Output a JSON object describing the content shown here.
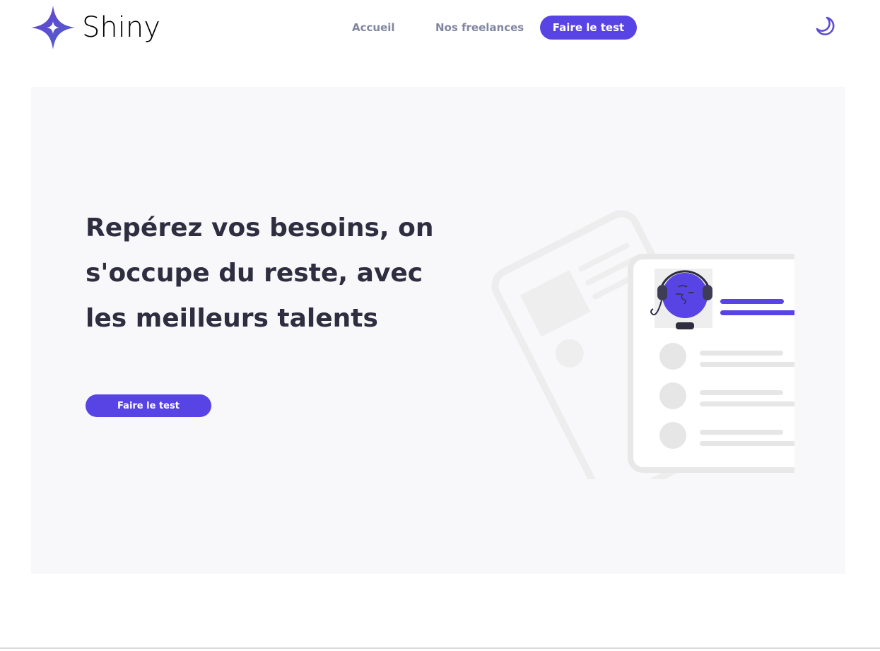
{
  "header": {
    "brand": "Shiny",
    "nav": {
      "home": "Accueil",
      "freelances": "Nos freelances",
      "test": "Faire le test"
    },
    "theme_toggle_icon": "moon-icon"
  },
  "hero": {
    "title": "Repérez vos besoins, on s'occupe du reste, avec les meilleurs talents",
    "cta": "Faire le test",
    "illustration": "freelancer-profile-card-illustration"
  },
  "colors": {
    "primary": "#5843E4",
    "nav_text": "#8186A0",
    "title_text": "#2F2E41",
    "hero_background": "#F8F8FA"
  }
}
